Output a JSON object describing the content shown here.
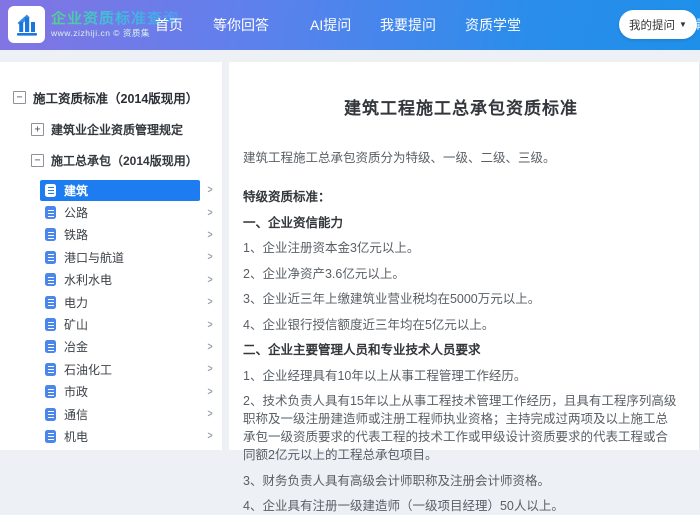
{
  "header": {
    "logo": {
      "title": "企业资质标准查询",
      "subtitle": "www.zizhiji.cn © 资质集",
      "icon": "building-logo-icon"
    },
    "nav": [
      {
        "label": "首页"
      },
      {
        "label": "等你回答"
      },
      {
        "label": "AI提问"
      },
      {
        "label": "我要提问"
      },
      {
        "label": "资质学堂"
      }
    ],
    "my_questions_button": {
      "label": "我的提问",
      "caret": "▼"
    },
    "partial_nav_text": "请"
  },
  "sidebar": {
    "root": {
      "label": "施工资质标准（2014版现用）",
      "toggle_glyph": "−"
    },
    "groups": [
      {
        "label": "建筑业企业资质管理规定",
        "toggle_glyph": "+"
      },
      {
        "label": "施工总承包（2014版现用）",
        "toggle_glyph": "−"
      }
    ],
    "items": [
      {
        "label": "建筑",
        "selected": true
      },
      {
        "label": "公路"
      },
      {
        "label": "铁路"
      },
      {
        "label": "港口与航道"
      },
      {
        "label": "水利水电"
      },
      {
        "label": "电力"
      },
      {
        "label": "矿山"
      },
      {
        "label": "冶金"
      },
      {
        "label": "石油化工"
      },
      {
        "label": "市政"
      },
      {
        "label": "通信"
      },
      {
        "label": "机电"
      }
    ],
    "chevron_glyph": "＞"
  },
  "main": {
    "title": "建筑工程施工总承包资质标准",
    "intro": "建筑工程施工总承包资质分为特级、一级、二级、三级。",
    "paragraphs": [
      {
        "text": "特级资质标准：",
        "bold": true
      },
      {
        "text": "一、企业资信能力",
        "bold": true
      },
      {
        "text": "1、企业注册资本金3亿元以上。",
        "bold": false
      },
      {
        "text": "2、企业净资产3.6亿元以上。",
        "bold": false
      },
      {
        "text": "3、企业近三年上缴建筑业营业税均在5000万元以上。",
        "bold": false
      },
      {
        "text": "4、企业银行授信额度近三年均在5亿元以上。",
        "bold": false
      },
      {
        "text": "二、企业主要管理人员和专业技术人员要求",
        "bold": true
      },
      {
        "text": "1、企业经理具有10年以上从事工程管理工作经历。",
        "bold": false
      },
      {
        "text": "2、技术负责人具有15年以上从事工程技术管理工作经历，且具有工程序列高级职称及一级注册建造师或注册工程师执业资格；主持完成过两项及以上施工总承包一级资质要求的代表工程的技术工作或甲级设计资质要求的代表工程或合同额2亿元以上的工程总承包项目。",
        "bold": false
      },
      {
        "text": "3、财务负责人具有高级会计师职称及注册会计师资格。",
        "bold": false
      },
      {
        "text": "4、企业具有注册一级建造师（一级项目经理）50人以上。",
        "bold": false
      }
    ]
  },
  "colors": {
    "header_gradient_start": "#8374e3",
    "header_gradient_end": "#1e90ea",
    "accent_blue": "#1d7df0",
    "sidebar_icon_blue": "#4a86ec",
    "body_text": "#595f66",
    "heading_text": "#33363b",
    "page_background": "#edf0f5"
  }
}
